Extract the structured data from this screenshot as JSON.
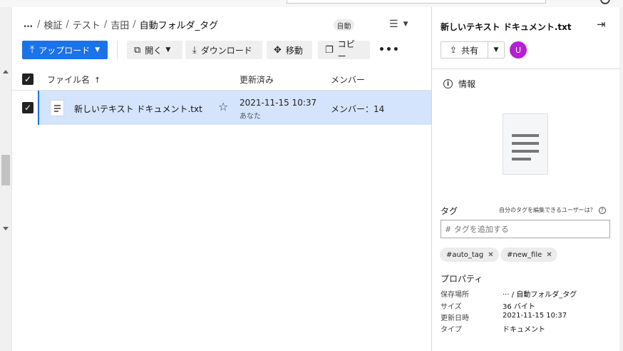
{
  "breadcrumb": {
    "more": "…",
    "items": [
      "検証",
      "テスト",
      "吉田"
    ],
    "current": "自動フォルダ_タグ",
    "badge": "自動"
  },
  "view_menu": {
    "icon": "list-view-icon"
  },
  "toolbar": {
    "upload": "アップロード",
    "open": "開く",
    "download": "ダウンロード",
    "move": "移動",
    "copy": "コピー",
    "more": "•••"
  },
  "table": {
    "headers": {
      "name": "ファイル名",
      "modified": "更新済み",
      "members": "メンバー"
    },
    "rows": [
      {
        "name": "新しいテキスト ドキュメント.txt",
        "modified_date": "2021-11-15 10:37",
        "modified_by": "あなた",
        "members": "メンバー：14",
        "selected": true
      }
    ]
  },
  "panel": {
    "title": "新しいテキスト ドキュメント.txt",
    "share_label": "共有",
    "avatar_initial": "U",
    "avatar_color": "#b51fd6",
    "info_label": "情報",
    "tags_label": "タグ",
    "tags_help": "自分のタグを編集できるユーザーは？",
    "tag_placeholder": "# タグを追加する",
    "tags": [
      "#auto_tag",
      "#new_file"
    ],
    "properties_label": "プロパティ",
    "properties": [
      {
        "key": "保存場所",
        "value": "··· / 自動フォルダ_タグ"
      },
      {
        "key": "サイズ",
        "value": "36 バイト"
      },
      {
        "key": "更新日時",
        "value": "2021-11-15 10:37"
      },
      {
        "key": "タイプ",
        "value": "ドキュメント"
      }
    ]
  },
  "colors": {
    "accent": "#1a73e8",
    "selected_row": "#d4e4fc"
  }
}
